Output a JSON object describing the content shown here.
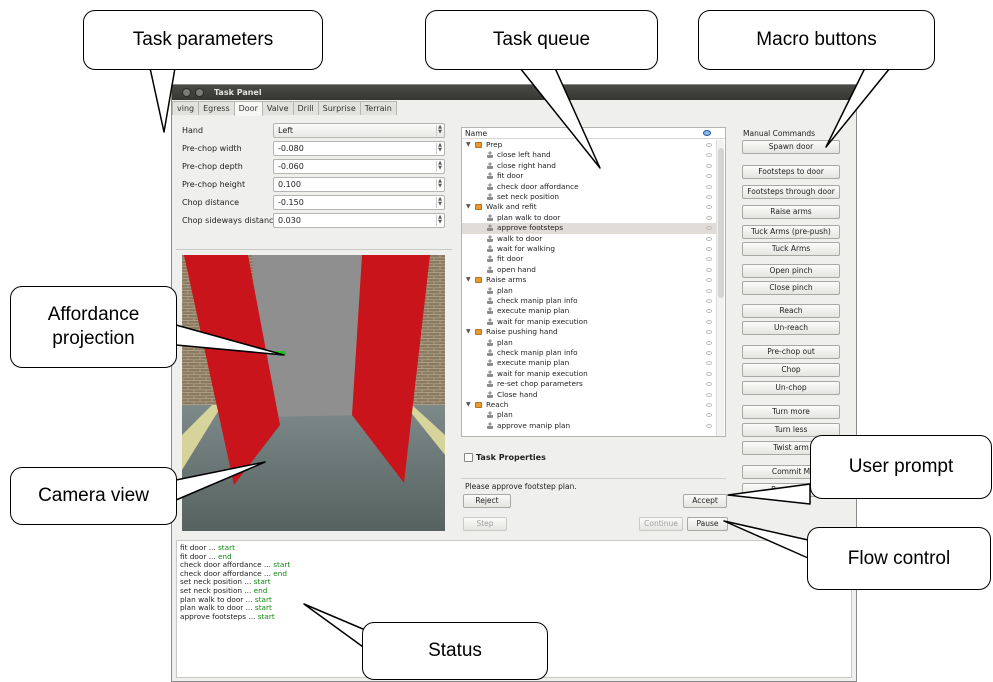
{
  "window": {
    "title": "Task Panel"
  },
  "tabs": [
    "ving",
    "Egress",
    "Door",
    "Valve",
    "Drill",
    "Surprise",
    "Terrain"
  ],
  "active_tab": "Door",
  "params": [
    {
      "label": "Hand",
      "value": "Left",
      "kind": "combo"
    },
    {
      "label": "Pre-chop width",
      "value": "-0.080",
      "kind": "spin"
    },
    {
      "label": "Pre-chop depth",
      "value": "-0.060",
      "kind": "spin"
    },
    {
      "label": "Pre-chop height",
      "value": "0.100",
      "kind": "spin"
    },
    {
      "label": "Chop distance",
      "value": "-0.150",
      "kind": "spin"
    },
    {
      "label": "Chop sideways distance",
      "value": "0.030",
      "kind": "spin"
    }
  ],
  "tree": {
    "header": "Name",
    "rows": [
      {
        "text": "Prep",
        "level": 0,
        "group": true
      },
      {
        "text": "close left hand",
        "level": 1
      },
      {
        "text": "close right hand",
        "level": 1
      },
      {
        "text": "fit door",
        "level": 1
      },
      {
        "text": "check door affordance",
        "level": 1
      },
      {
        "text": "set neck position",
        "level": 1
      },
      {
        "text": "Walk and refit",
        "level": 0,
        "group": true
      },
      {
        "text": "plan walk to door",
        "level": 1
      },
      {
        "text": "approve footsteps",
        "level": 1,
        "selected": true
      },
      {
        "text": "walk to door",
        "level": 1
      },
      {
        "text": "wait for walking",
        "level": 1
      },
      {
        "text": "fit door",
        "level": 1
      },
      {
        "text": "open hand",
        "level": 1
      },
      {
        "text": "Raise arms",
        "level": 0,
        "group": true
      },
      {
        "text": "plan",
        "level": 1
      },
      {
        "text": "check manip plan info",
        "level": 1
      },
      {
        "text": "execute manip plan",
        "level": 1
      },
      {
        "text": "wait for manip execution",
        "level": 1
      },
      {
        "text": "Raise pushing hand",
        "level": 0,
        "group": true
      },
      {
        "text": "plan",
        "level": 1
      },
      {
        "text": "check manip plan info",
        "level": 1
      },
      {
        "text": "execute manip plan",
        "level": 1
      },
      {
        "text": "wait for manip execution",
        "level": 1
      },
      {
        "text": "re-set chop parameters",
        "level": 1
      },
      {
        "text": "Close hand",
        "level": 1
      },
      {
        "text": "Reach",
        "level": 0,
        "group": true
      },
      {
        "text": "plan",
        "level": 1
      },
      {
        "text": "approve manip plan",
        "level": 1
      }
    ]
  },
  "task_properties_label": "Task Properties",
  "prompt": {
    "text": "Please approve footstep plan.",
    "reject": "Reject",
    "accept": "Accept"
  },
  "flow": {
    "step": "Step",
    "continue": "Continue",
    "pause": "Pause"
  },
  "manual_commands": {
    "title": "Manual Commands",
    "buttons": [
      "Spawn door",
      "Footsteps to door",
      "Footsteps through door",
      "Raise arms",
      "Tuck Arms (pre-push)",
      "Tuck Arms",
      "Open pinch",
      "Close pinch",
      "Reach",
      "Un-reach",
      "Pre-chop out",
      "Chop",
      "Un-chop",
      "Turn more",
      "Turn less",
      "Twist arm",
      "Commit M",
      "Reset joint"
    ]
  },
  "status_lines": [
    {
      "task": "fit door ... ",
      "state": "start"
    },
    {
      "task": "fit door ... ",
      "state": "end"
    },
    {
      "task": "check door affordance ... ",
      "state": "start"
    },
    {
      "task": "check door affordance ... ",
      "state": "end"
    },
    {
      "task": "set neck position ... ",
      "state": "start"
    },
    {
      "task": "set neck position ... ",
      "state": "end"
    },
    {
      "task": "plan walk to door ... ",
      "state": "start"
    },
    {
      "task": "plan walk to door ... ",
      "state": "start"
    },
    {
      "task": "approve footsteps ... ",
      "state": "start"
    }
  ],
  "colors": {
    "status_ok": "#118811",
    "door_frame": "#c8141a",
    "folder": "#e89a30"
  },
  "callouts": {
    "task_parameters": "Task parameters",
    "task_queue": "Task queue",
    "macro_buttons": "Macro buttons",
    "affordance_line1": "Affordance",
    "affordance_line2": "projection",
    "camera_view": "Camera view",
    "user_prompt": "User prompt",
    "flow_control": "Flow control",
    "status": "Status"
  }
}
